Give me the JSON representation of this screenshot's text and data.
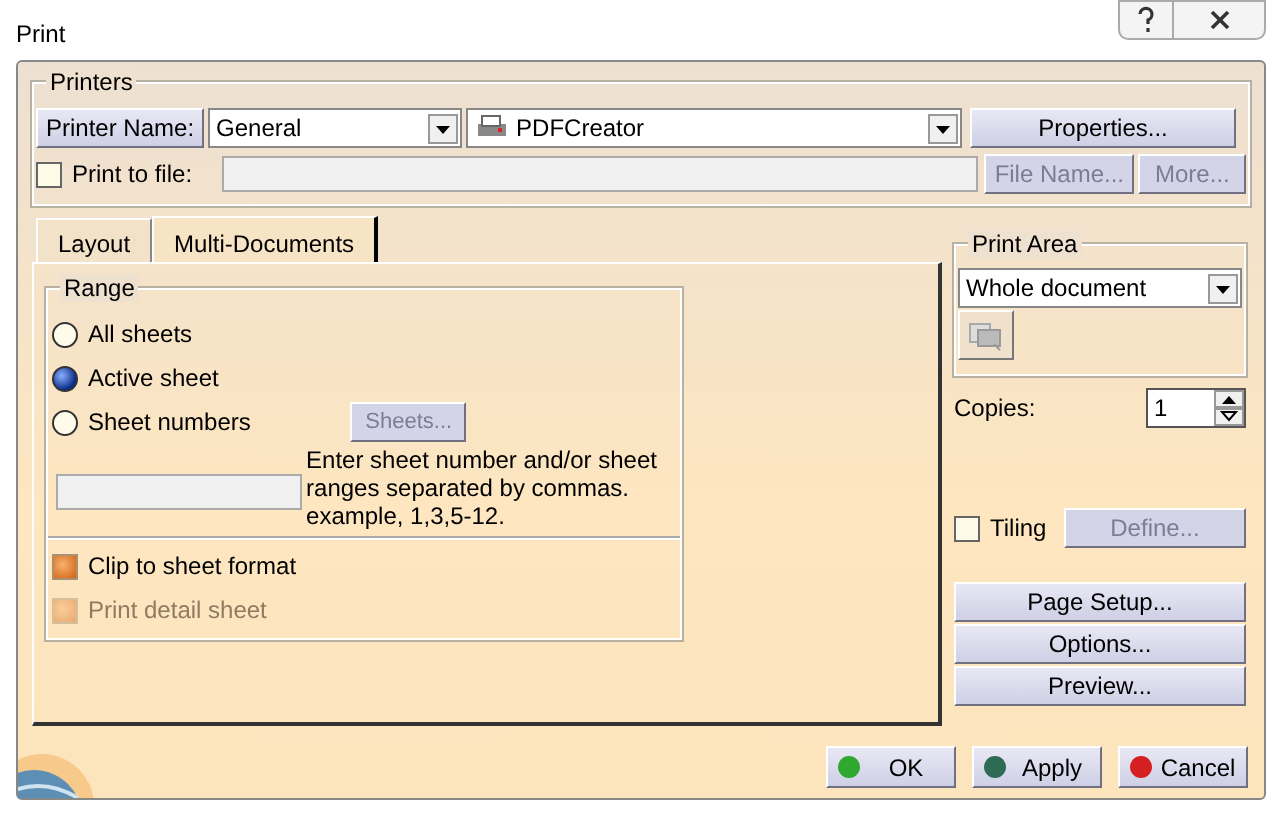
{
  "window": {
    "title": "Print"
  },
  "printers": {
    "title": "Printers",
    "name_button": "Printer Name:",
    "printer_name": "General",
    "printer": "PDFCreator",
    "properties_button": "Properties...",
    "print_to_file": {
      "label": "Print to file:",
      "checked": false
    },
    "file_name_button": {
      "label": "File Name...",
      "disabled": true
    },
    "more_button": {
      "label": "More...",
      "disabled": true
    }
  },
  "tabs": [
    {
      "label": "Layout",
      "selected": false
    },
    {
      "label": "Multi-Documents",
      "selected": true
    }
  ],
  "range": {
    "title": "Range",
    "options": [
      {
        "label": "All sheets",
        "selected": false
      },
      {
        "label": "Active sheet",
        "selected": true
      },
      {
        "label": "Sheet numbers",
        "selected": false
      }
    ],
    "sheets_button": {
      "label": "Sheets...",
      "disabled": true
    },
    "hint": "Enter sheet number and/or sheet ranges separated by commas. example, 1,3,5-12.",
    "checkboxes": [
      {
        "label": "Clip to sheet format",
        "checked": true,
        "disabled": false
      },
      {
        "label": "Print detail sheet",
        "checked": true,
        "disabled": true
      }
    ]
  },
  "print_area": {
    "title": "Print Area",
    "value": "Whole document"
  },
  "copies": {
    "label": "Copies:",
    "value": "1"
  },
  "tiling": {
    "label": "Tiling",
    "checked": false
  },
  "define_button": {
    "label": "Define...",
    "disabled": true
  },
  "side_buttons": [
    "Page Setup...",
    "Options...",
    "Preview..."
  ],
  "footer_buttons": [
    {
      "label": "OK",
      "color": "#2ea82e"
    },
    {
      "label": "Apply",
      "color": "#2d6b55"
    },
    {
      "label": "Cancel",
      "color": "#d42020"
    }
  ]
}
